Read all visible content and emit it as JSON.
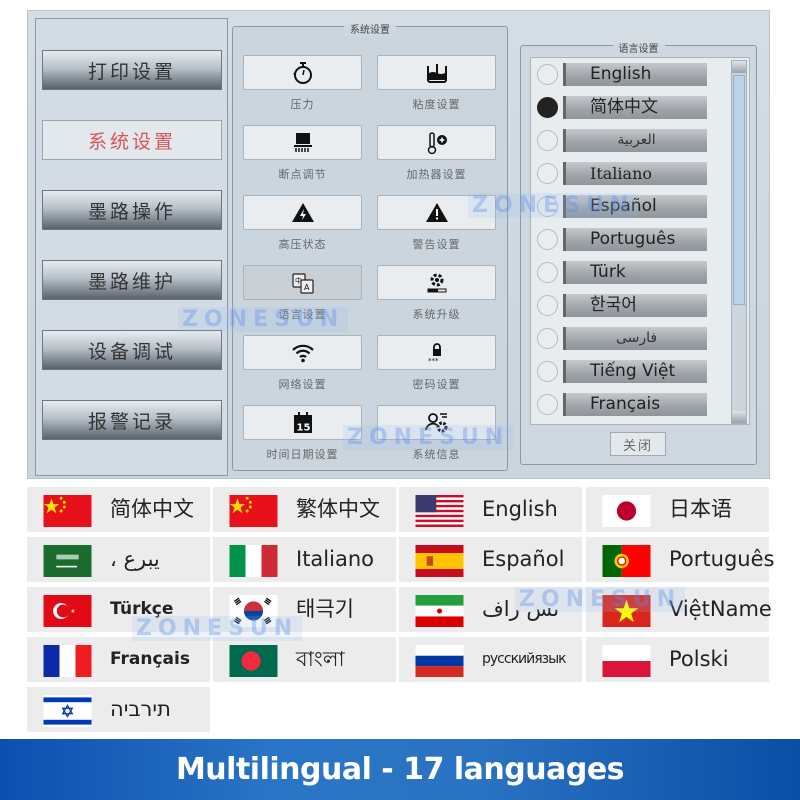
{
  "screen": {
    "menu": [
      {
        "label": "打印设置",
        "active": false
      },
      {
        "label": "系统设置",
        "active": true
      },
      {
        "label": "墨路操作",
        "active": false
      },
      {
        "label": "墨路维护",
        "active": false
      },
      {
        "label": "设备调试",
        "active": false
      },
      {
        "label": "报警记录",
        "active": false
      }
    ],
    "system_panel": {
      "title": "系统设置",
      "tiles": [
        {
          "label": "压力",
          "icon": "stopwatch-icon"
        },
        {
          "label": "粘度设置",
          "icon": "viscosity-beaker-icon"
        },
        {
          "label": "断点调节",
          "icon": "printer-breakpoint-icon"
        },
        {
          "label": "加热器设置",
          "icon": "thermometer-plus-icon"
        },
        {
          "label": "高压状态",
          "icon": "high-voltage-warning-icon"
        },
        {
          "label": "警告设置",
          "icon": "warning-icon"
        },
        {
          "label": "语言设置",
          "icon": "language-translate-icon",
          "selected": true
        },
        {
          "label": "系统升级",
          "icon": "gear-upgrade-icon"
        },
        {
          "label": "网络设置",
          "icon": "wifi-icon"
        },
        {
          "label": "密码设置",
          "icon": "lock-password-icon"
        },
        {
          "label": "时间日期设置",
          "icon": "calendar-icon",
          "calendar_day": "15"
        },
        {
          "label": "系统信息",
          "icon": "user-gear-icon"
        }
      ]
    },
    "language_panel": {
      "title": "语言设置",
      "options": [
        {
          "label": "English",
          "selected": false
        },
        {
          "label": "简体中文",
          "selected": true
        },
        {
          "label": "العربية",
          "selected": false
        },
        {
          "label": "Italiano",
          "selected": false
        },
        {
          "label": "Español",
          "selected": false
        },
        {
          "label": "Português",
          "selected": false
        },
        {
          "label": "Türk",
          "selected": false
        },
        {
          "label": "한국어",
          "selected": false
        },
        {
          "label": "فارسی",
          "selected": false
        },
        {
          "label": "Tiếng Việt",
          "selected": false
        },
        {
          "label": "Français",
          "selected": false
        }
      ],
      "close_label": "关闭"
    },
    "watermark": "ZONESUN"
  },
  "languages": [
    {
      "label": "简体中文",
      "flag": "china-flag-icon"
    },
    {
      "label": "繁体中文",
      "flag": "china-flag-icon"
    },
    {
      "label": "English",
      "flag": "usa-flag-icon"
    },
    {
      "label": "日本语",
      "flag": "japan-flag-icon"
    },
    {
      "label": "، يبرع",
      "flag": "saudi-arabia-flag-icon"
    },
    {
      "label": "Italiano",
      "flag": "italy-flag-icon"
    },
    {
      "label": "Español",
      "flag": "spain-flag-icon"
    },
    {
      "label": "Português",
      "flag": "portugal-flag-icon"
    },
    {
      "label": "Türkçe",
      "flag": "turkey-flag-icon"
    },
    {
      "label": "태극기",
      "flag": "south-korea-flag-icon"
    },
    {
      "label": "ىس راف",
      "flag": "iran-flag-icon"
    },
    {
      "label": "ViệtName",
      "flag": "vietnam-flag-icon"
    },
    {
      "label": "Français",
      "flag": "france-flag-icon"
    },
    {
      "label": "বাংলা",
      "flag": "bangladesh-flag-icon"
    },
    {
      "label": "русскийязык",
      "flag": "russia-flag-icon"
    },
    {
      "label": "Polski",
      "flag": "poland-flag-icon"
    },
    {
      "label": "תירביה",
      "flag": "israel-flag-icon"
    }
  ],
  "banner": {
    "text": "Multilingual - 17 languages",
    "color_start": "#0d4fb0",
    "color_end": "#0a4ea6"
  }
}
